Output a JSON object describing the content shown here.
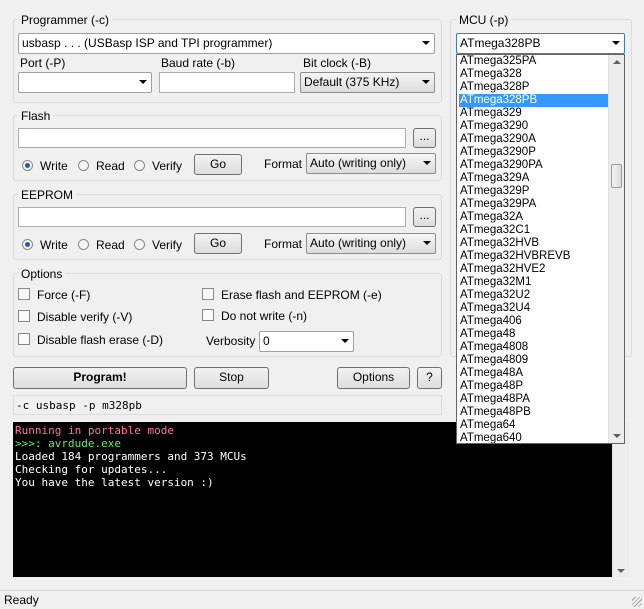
{
  "programmer": {
    "title": "Programmer (-c)",
    "value": "usbasp . . . (USBasp ISP and TPI programmer)",
    "port_label": "Port (-P)",
    "port_value": "",
    "baud_label": "Baud rate (-b)",
    "baud_value": "",
    "bitclock_label": "Bit clock (-B)",
    "bitclock_value": "Default (375 KHz)"
  },
  "mcu": {
    "title": "MCU (-p)",
    "selected": "ATmega328PB",
    "options": [
      "ATmega325PA",
      "ATmega328",
      "ATmega328P",
      "ATmega328PB",
      "ATmega329",
      "ATmega3290",
      "ATmega3290A",
      "ATmega3290P",
      "ATmega3290PA",
      "ATmega329A",
      "ATmega329P",
      "ATmega329PA",
      "ATmega32A",
      "ATmega32C1",
      "ATmega32HVB",
      "ATmega32HVBREVB",
      "ATmega32HVE2",
      "ATmega32M1",
      "ATmega32U2",
      "ATmega32U4",
      "ATmega406",
      "ATmega48",
      "ATmega4808",
      "ATmega4809",
      "ATmega48A",
      "ATmega48P",
      "ATmega48PA",
      "ATmega48PB",
      "ATmega64",
      "ATmega640"
    ]
  },
  "flash": {
    "title": "Flash",
    "path": "",
    "browse": "...",
    "write": "Write",
    "read": "Read",
    "verify": "Verify",
    "go": "Go",
    "format_label": "Format",
    "format_value": "Auto (writing only)",
    "mode": "write"
  },
  "eeprom": {
    "title": "EEPROM",
    "path": "",
    "browse": "...",
    "write": "Write",
    "read": "Read",
    "verify": "Verify",
    "go": "Go",
    "format_label": "Format",
    "format_value": "Auto (writing only)",
    "mode": "write"
  },
  "options": {
    "title": "Options",
    "force": "Force (-F)",
    "disable_verify": "Disable verify (-V)",
    "disable_flash_erase": "Disable flash erase (-D)",
    "erase": "Erase flash and EEPROM (-e)",
    "no_write": "Do not write (-n)",
    "verbosity_label": "Verbosity",
    "verbosity_value": "0"
  },
  "actions": {
    "program": "Program!",
    "stop": "Stop",
    "options": "Options",
    "help": "?"
  },
  "command": "-c usbasp -p m328pb",
  "console": {
    "lines": [
      {
        "text": "Running in portable mode",
        "color": "#ff6fa8"
      },
      {
        "text": ">>>: avrdude.exe",
        "color": "#5cf05c"
      },
      {
        "text": "Loaded 184 programmers and 373 MCUs",
        "color": "#ffffff"
      },
      {
        "text": "Checking for updates...",
        "color": "#ffffff"
      },
      {
        "text": "You have the latest version :)",
        "color": "#ffffff"
      }
    ]
  },
  "status": "Ready",
  "colors": {
    "selection": "#3399ff",
    "console_bg": "#000000"
  }
}
